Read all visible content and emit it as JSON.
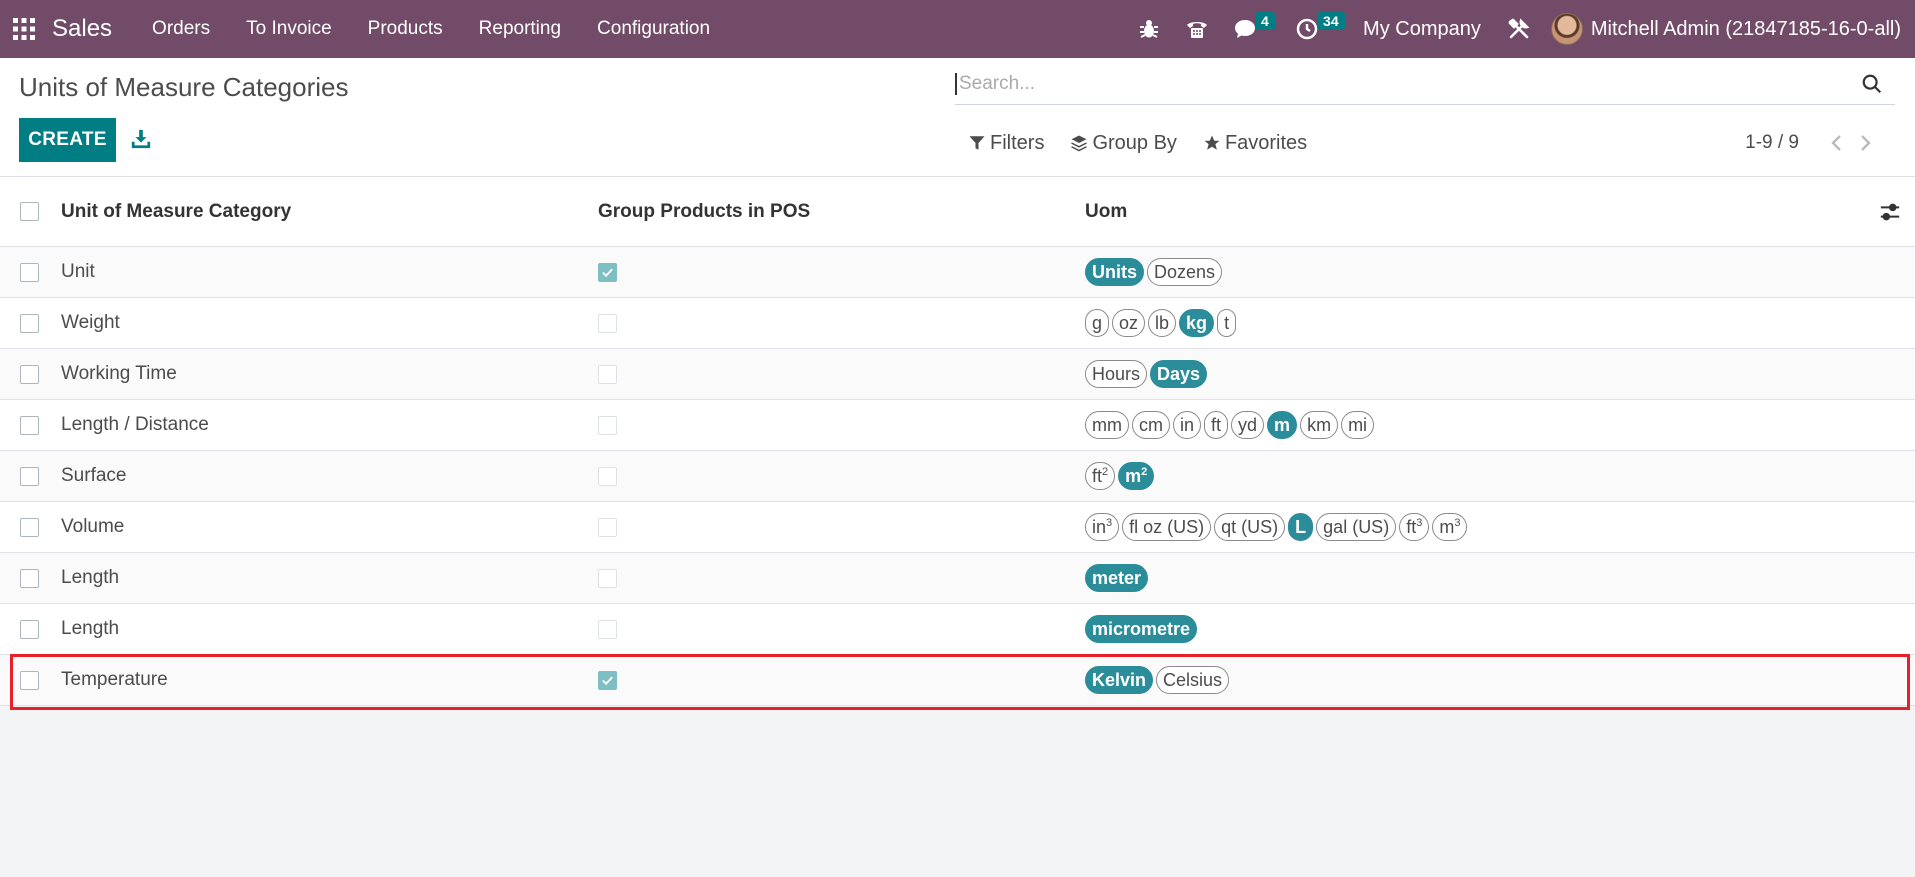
{
  "navbar": {
    "app_name": "Sales",
    "menu": [
      "Orders",
      "To Invoice",
      "Products",
      "Reporting",
      "Configuration"
    ],
    "messages_count": "4",
    "activities_count": "34",
    "company": "My Company",
    "user": "Mitchell Admin (21847185-16-0-all)",
    "bg_color": "#714b67"
  },
  "control_panel": {
    "title": "Units of Measure Categories",
    "create_label": "CREATE",
    "search_placeholder": "Search...",
    "filters_label": "Filters",
    "groupby_label": "Group By",
    "favorites_label": "Favorites",
    "pager_value": "1-9 / 9"
  },
  "table": {
    "headers": [
      "Unit of Measure Category",
      "Group Products in POS",
      "Uom"
    ],
    "rows": [
      {
        "name": "Unit",
        "pos": true,
        "uoms": [
          {
            "t": "Units",
            "a": true
          },
          {
            "t": "Dozens",
            "a": false
          }
        ]
      },
      {
        "name": "Weight",
        "pos": false,
        "uoms": [
          {
            "t": "g",
            "a": false
          },
          {
            "t": "oz",
            "a": false
          },
          {
            "t": "lb",
            "a": false
          },
          {
            "t": "kg",
            "a": true
          },
          {
            "t": "t",
            "a": false
          }
        ]
      },
      {
        "name": "Working Time",
        "pos": false,
        "uoms": [
          {
            "t": "Hours",
            "a": false
          },
          {
            "t": "Days",
            "a": true
          }
        ]
      },
      {
        "name": "Length / Distance",
        "pos": false,
        "uoms": [
          {
            "t": "mm",
            "a": false
          },
          {
            "t": "cm",
            "a": false
          },
          {
            "t": "in",
            "a": false
          },
          {
            "t": "ft",
            "a": false
          },
          {
            "t": "yd",
            "a": false
          },
          {
            "t": "m",
            "a": true
          },
          {
            "t": "km",
            "a": false
          },
          {
            "t": "mi",
            "a": false
          }
        ]
      },
      {
        "name": "Surface",
        "pos": false,
        "uoms": [
          {
            "t": "ft",
            "sup": "2",
            "a": false
          },
          {
            "t": "m",
            "sup": "2",
            "a": true
          }
        ]
      },
      {
        "name": "Volume",
        "pos": false,
        "uoms": [
          {
            "t": "in",
            "sup": "3",
            "a": false
          },
          {
            "t": "fl oz (US)",
            "a": false
          },
          {
            "t": "qt (US)",
            "a": false
          },
          {
            "t": "L",
            "a": true
          },
          {
            "t": "gal (US)",
            "a": false
          },
          {
            "t": "ft",
            "sup": "3",
            "a": false
          },
          {
            "t": "m",
            "sup": "3",
            "a": false
          }
        ]
      },
      {
        "name": "Length",
        "pos": false,
        "uoms": [
          {
            "t": "meter",
            "a": true
          }
        ]
      },
      {
        "name": "Length",
        "pos": false,
        "uoms": [
          {
            "t": "micrometre",
            "a": true
          }
        ]
      },
      {
        "name": "Temperature",
        "pos": true,
        "uoms": [
          {
            "t": "Kelvin",
            "a": true
          },
          {
            "t": "Celsius",
            "a": false
          }
        ]
      }
    ]
  },
  "colors": {
    "primary": "#017e84",
    "tag_active": "#2a8d99",
    "highlight": "#e8202a"
  }
}
